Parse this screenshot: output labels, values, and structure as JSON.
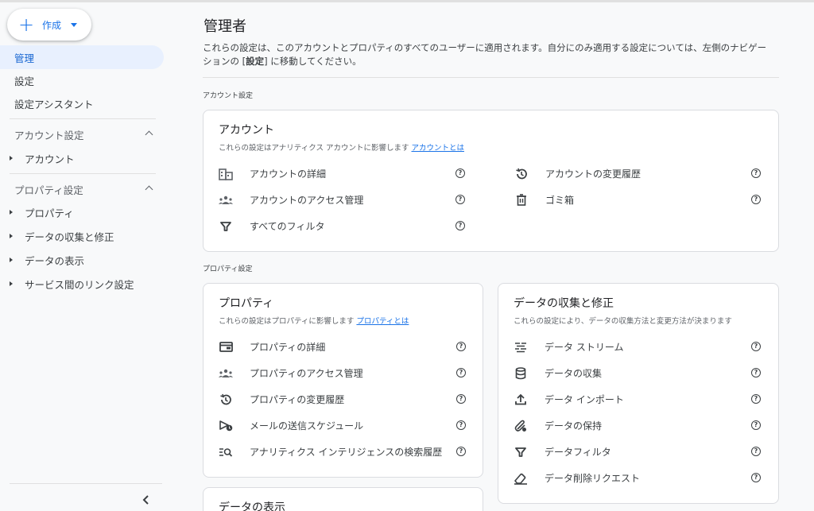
{
  "sidebar": {
    "create_label": "作成",
    "items": [
      {
        "label": "管理"
      },
      {
        "label": "設定"
      },
      {
        "label": "設定アシスタント"
      }
    ],
    "account_section": "アカウント設定",
    "account_items": [
      "アカウント"
    ],
    "property_section": "プロパティ設定",
    "property_items": [
      "プロパティ",
      "データの収集と修正",
      "データの表示",
      "サービス間のリンク設定"
    ]
  },
  "main": {
    "title": "管理者",
    "desc_line1": "これらの設定は、このアカウントとプロパティのすべてのユーザーに適用されます。自分にのみ適用する設定については、左側のナビゲー",
    "desc_line2_pre": "ションの [",
    "desc_line2_bold": "設定",
    "desc_line2_post": "] に移動してください。",
    "account_settings_heading": "アカウント設定",
    "property_settings_heading": "プロパティ設定"
  },
  "account_card": {
    "title": "アカウント",
    "subtitle": "これらの設定はアナリティクス アカウントに影響します",
    "link": "アカウントとは",
    "left": [
      "アカウントの詳細",
      "アカウントのアクセス管理",
      "すべてのフィルタ"
    ],
    "right": [
      "アカウントの変更履歴",
      "ゴミ箱"
    ]
  },
  "property_card": {
    "title": "プロパティ",
    "subtitle": "これらの設定はプロパティに影響します",
    "link": "プロパティとは",
    "items": [
      "プロパティの詳細",
      "プロパティのアクセス管理",
      "プロパティの変更履歴",
      "メールの送信スケジュール",
      "アナリティクス インテリジェンスの検索履歴"
    ]
  },
  "data_collection_card": {
    "title": "データの収集と修正",
    "subtitle": "これらの設定により、データの収集方法と変更方法が決まります",
    "items": [
      "データ ストリーム",
      "データの収集",
      "データ インポート",
      "データの保持",
      "データフィルタ",
      "データ削除リクエスト"
    ]
  },
  "data_display_card": {
    "title": "データの表示"
  },
  "colors": {
    "accent": "#1a73e8",
    "active_bg": "#e8f0fe"
  }
}
